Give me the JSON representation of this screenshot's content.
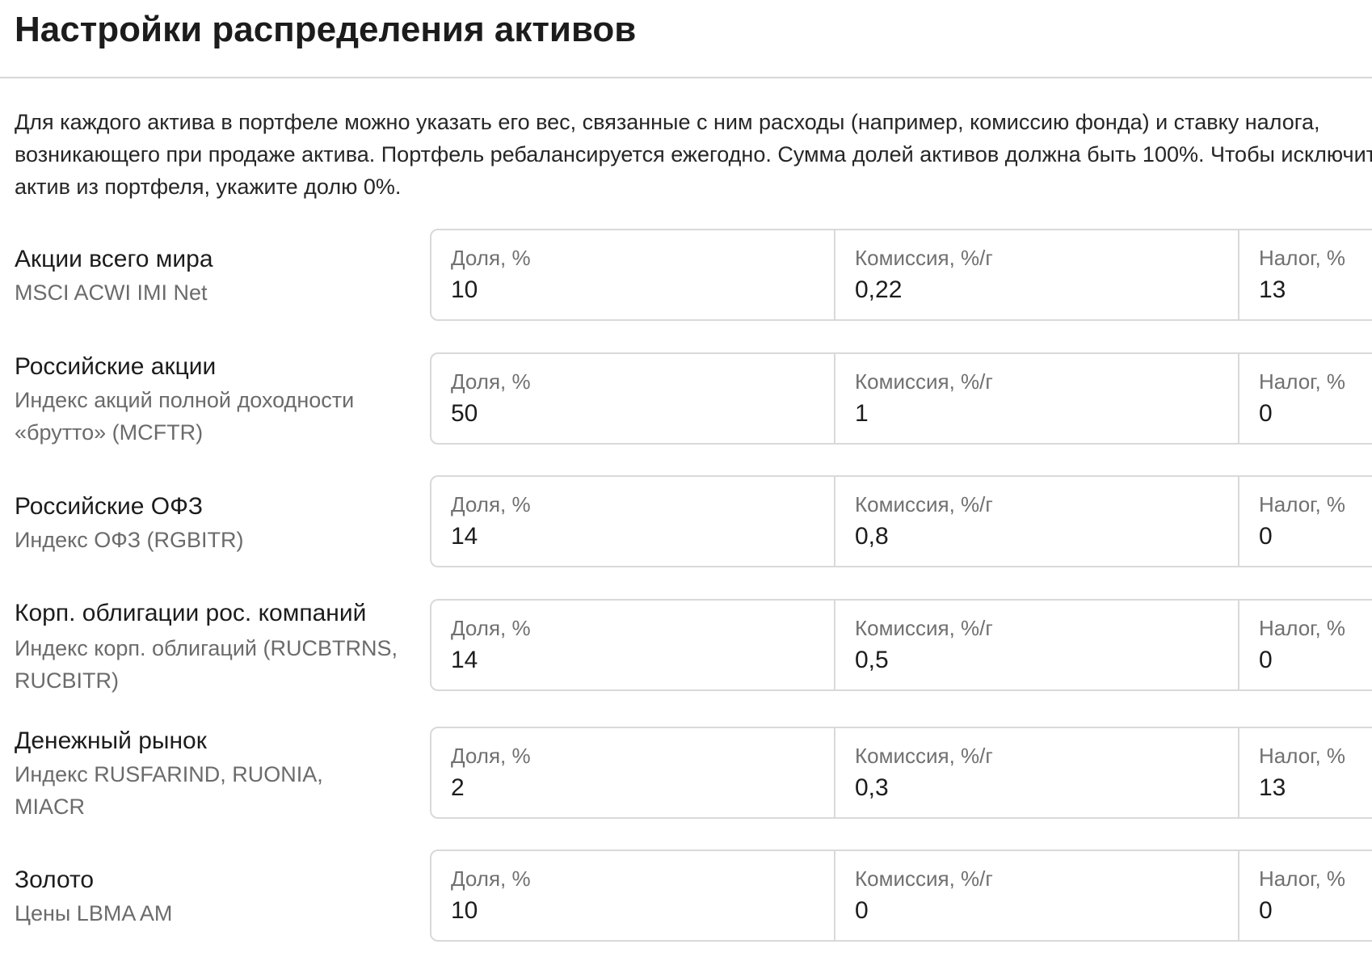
{
  "title": "Настройки распределения активов",
  "description": "Для каждого актива в портфеле можно указать его вес, связанные с ним расходы (например, комиссию фонда) и ставку налога, возникающего при продаже актива. Портфель ребалансируется ежегодно. Сумма долей активов должна быть 100%. Чтобы исключить актив из портфеля, укажите долю 0%.",
  "labels": {
    "share": "Доля, %",
    "fee": "Комиссия, %/г",
    "tax": "Налог, %"
  },
  "assets": [
    {
      "name": "Акции всего мира",
      "index": "MSCI ACWI IMI Net",
      "share": "10",
      "fee": "0,22",
      "tax": "13"
    },
    {
      "name": "Российские акции",
      "index": "Индекс акций полной доходности «брутто» (MCFTR)",
      "share": "50",
      "fee": "1",
      "tax": "0"
    },
    {
      "name": "Российские ОФЗ",
      "index": "Индекс ОФЗ (RGBITR)",
      "share": "14",
      "fee": "0,8",
      "tax": "0"
    },
    {
      "name": "Корп. облигации рос. компаний",
      "index": "Индекс корп. облигаций (RUCBTRNS, RUCBITR)",
      "share": "14",
      "fee": "0,5",
      "tax": "0"
    },
    {
      "name": "Денежный рынок",
      "index": "Индекс RUSFARIND, RUONIA, MIACR",
      "share": "2",
      "fee": "0,3",
      "tax": "13"
    },
    {
      "name": "Золото",
      "index": "Цены LBMA AM",
      "share": "10",
      "fee": "0",
      "tax": "0"
    }
  ]
}
